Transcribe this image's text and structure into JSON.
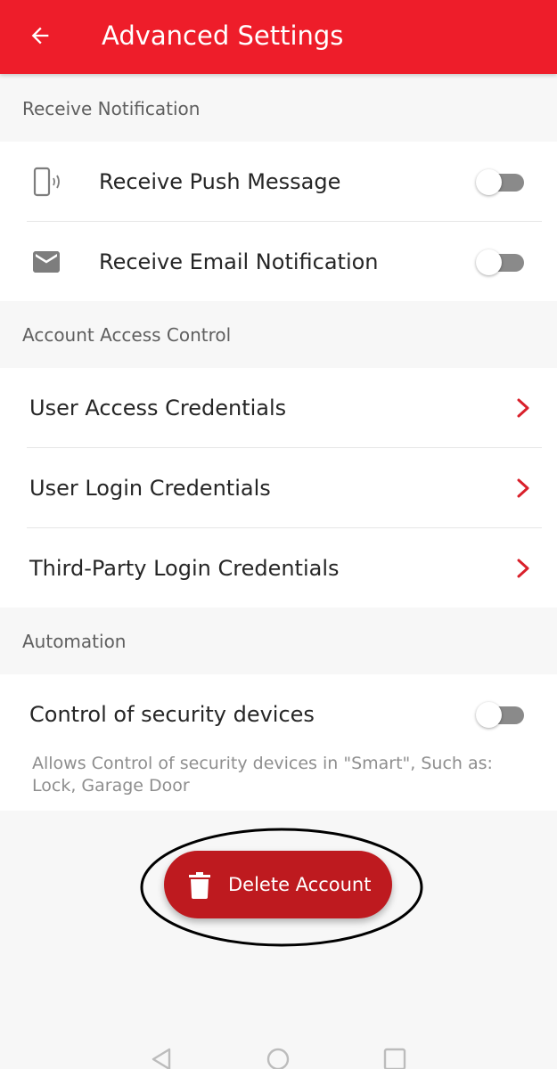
{
  "appbar": {
    "title": "Advanced Settings",
    "back_icon": "arrow-left-icon",
    "background_color": "#ee1d2a"
  },
  "sections": {
    "notifications": {
      "label": "Receive Notification",
      "items": [
        {
          "label": "Receive Push Message",
          "icon": "phone-vibrate-icon",
          "enabled": false
        },
        {
          "label": "Receive Email Notification",
          "icon": "mail-icon",
          "enabled": false
        }
      ]
    },
    "access_control": {
      "label": "Account Access Control",
      "items": [
        {
          "label": "User Access Credentials",
          "icon": "chevron-right-icon"
        },
        {
          "label": "User Login Credentials",
          "icon": "chevron-right-icon"
        },
        {
          "label": "Third-Party Login Credentials",
          "icon": "chevron-right-icon"
        }
      ]
    },
    "automation": {
      "label": "Automation",
      "items": [
        {
          "label": "Control of security devices",
          "enabled": false,
          "description": "Allows Control of security devices in \"Smart\", Such as: Lock, Garage Door"
        }
      ]
    }
  },
  "delete_account": {
    "label": "Delete Account",
    "icon": "trash-icon",
    "color": "#be1a1f"
  },
  "navbar": {
    "icons": [
      "back-triangle-icon",
      "home-circle-icon",
      "recents-square-icon"
    ]
  },
  "colors": {
    "accent": "#ee1d2a",
    "chevron": "#d9202b",
    "toggle_off_track": "#8a8a8a"
  }
}
